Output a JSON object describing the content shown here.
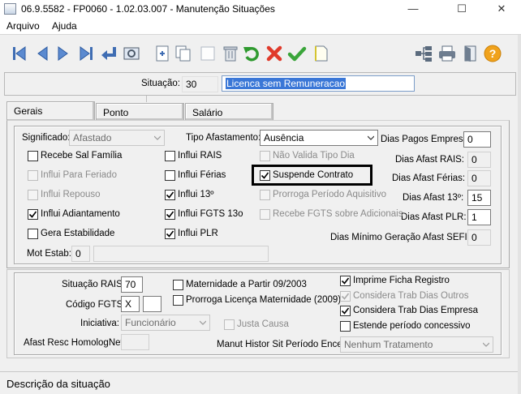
{
  "window": {
    "title": "06.9.5582 - FP0060 - 1.02.03.007 - Manutenção Situações",
    "minimize": "—",
    "maximize": "☐",
    "close": "✕"
  },
  "menu": [
    "Arquivo",
    "Ajuda"
  ],
  "toolbar_icons": [
    "first-record-icon",
    "previous-record-icon",
    "next-record-icon",
    "last-record-icon",
    "enter-icon",
    "preview-icon",
    "new-record-icon",
    "copy-record-icon",
    "blank-icon",
    "delete-icon",
    "undo-icon",
    "cancel-icon",
    "confirm-icon",
    "new-document-icon",
    "hierarchy-icon",
    "print-icon",
    "exit-icon",
    "help-icon"
  ],
  "situacao": {
    "label": "Situação:",
    "code": "30",
    "description": "Licenca sem Remuneracao"
  },
  "tabs": [
    "Gerais",
    "Ponto",
    "Salário"
  ],
  "gerais": {
    "significado_label": "Significado:",
    "significado_value": "Afastado",
    "tipo_afastamento_label": "Tipo Afastamento:",
    "tipo_afastamento_value": "Ausência",
    "dias_pagos_label": "Dias Pagos Empresa:",
    "dias_pagos_value": "0",
    "dias_afast_rais_label": "Dias Afast RAIS:",
    "dias_afast_rais_value": "0",
    "dias_afast_ferias_label": "Dias Afast Férias:",
    "dias_afast_ferias_value": "0",
    "dias_afast_13_label": "Dias Afast 13º:",
    "dias_afast_13_value": "15",
    "dias_afast_plr_label": "Dias Afast PLR:",
    "dias_afast_plr_value": "1",
    "dias_minimo_sefip_label": "Dias Mínimo Geração Afast SEFIP:",
    "dias_minimo_sefip_value": "0",
    "mot_estab_label": "Mot Estab:",
    "mot_estab_value": "0",
    "col1": [
      {
        "label": "Recebe Sal Família",
        "checked": false,
        "enabled": true
      },
      {
        "label": "Influi Para Feriado",
        "checked": false,
        "enabled": false
      },
      {
        "label": "Influi Repouso",
        "checked": false,
        "enabled": false
      },
      {
        "label": "Influi Adiantamento",
        "checked": true,
        "enabled": true
      },
      {
        "label": "Gera Estabilidade",
        "checked": false,
        "enabled": true
      }
    ],
    "col2": [
      {
        "label": "Influi RAIS",
        "checked": false,
        "enabled": true
      },
      {
        "label": "Influi Férias",
        "checked": false,
        "enabled": true
      },
      {
        "label": "Influi 13º",
        "checked": true,
        "enabled": true
      },
      {
        "label": "Influi FGTS 13o",
        "checked": true,
        "enabled": true
      },
      {
        "label": "Influi PLR",
        "checked": true,
        "enabled": true
      }
    ],
    "col3": [
      {
        "label": "Não Valida Tipo Dia",
        "checked": false,
        "enabled": false
      },
      {
        "label": "Suspende Contrato",
        "checked": true,
        "enabled": true
      },
      {
        "label": "Prorroga Período Aquisitivo",
        "checked": false,
        "enabled": false
      },
      {
        "label": "Recebe FGTS sobre Adicionais",
        "checked": false,
        "enabled": false
      }
    ]
  },
  "lower": {
    "situacao_rais_label": "Situação RAIS:",
    "situacao_rais_value": "70",
    "codigo_fgts_label": "Código FGTS:",
    "codigo_fgts_value": "X",
    "codigo_fgts_value2": "",
    "iniciativa_label": "Iniciativa:",
    "iniciativa_value": "Funcionário",
    "afast_resc_label": "Afast Resc HomologNet:",
    "afast_resc_value": "",
    "maternidade_label": "Maternidade a Partir 09/2003",
    "prorroga_label": "Prorroga Licença Maternidade (2009)",
    "justa_causa_label": "Justa Causa",
    "imprime_label": "Imprime Ficha Registro",
    "considera_outros_label": "Considera Trab Dias Outros",
    "considera_empresa_label": "Considera Trab Dias Empresa",
    "estende_label": "Estende período concessivo",
    "manut_label": "Manut Histor Sit Período Encer:",
    "manut_value": "Nenhum Tratamento"
  },
  "status_bar": "Descrição da situação"
}
